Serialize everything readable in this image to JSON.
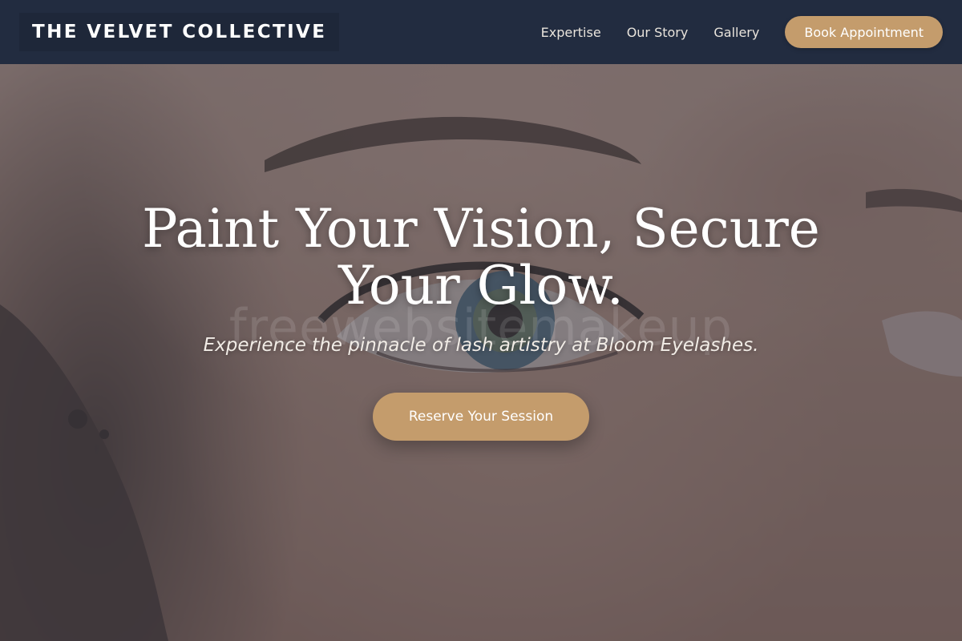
{
  "header": {
    "brand": "THE VELVET COLLECTIVE",
    "nav": [
      {
        "label": "Expertise"
      },
      {
        "label": "Our Story"
      },
      {
        "label": "Gallery"
      }
    ],
    "cta_label": "Book Appointment"
  },
  "hero": {
    "title_line1": "Paint Your Vision, Secure",
    "title_line2": "Your Glow.",
    "subtitle": "Experience the pinnacle of lash artistry at Bloom Eyelashes.",
    "cta_label": "Reserve Your Session",
    "watermark": "freewebsitemakeup"
  },
  "colors": {
    "header_bg": "#222c40",
    "accent": "#c49c6c",
    "text_light": "#ffffff"
  }
}
